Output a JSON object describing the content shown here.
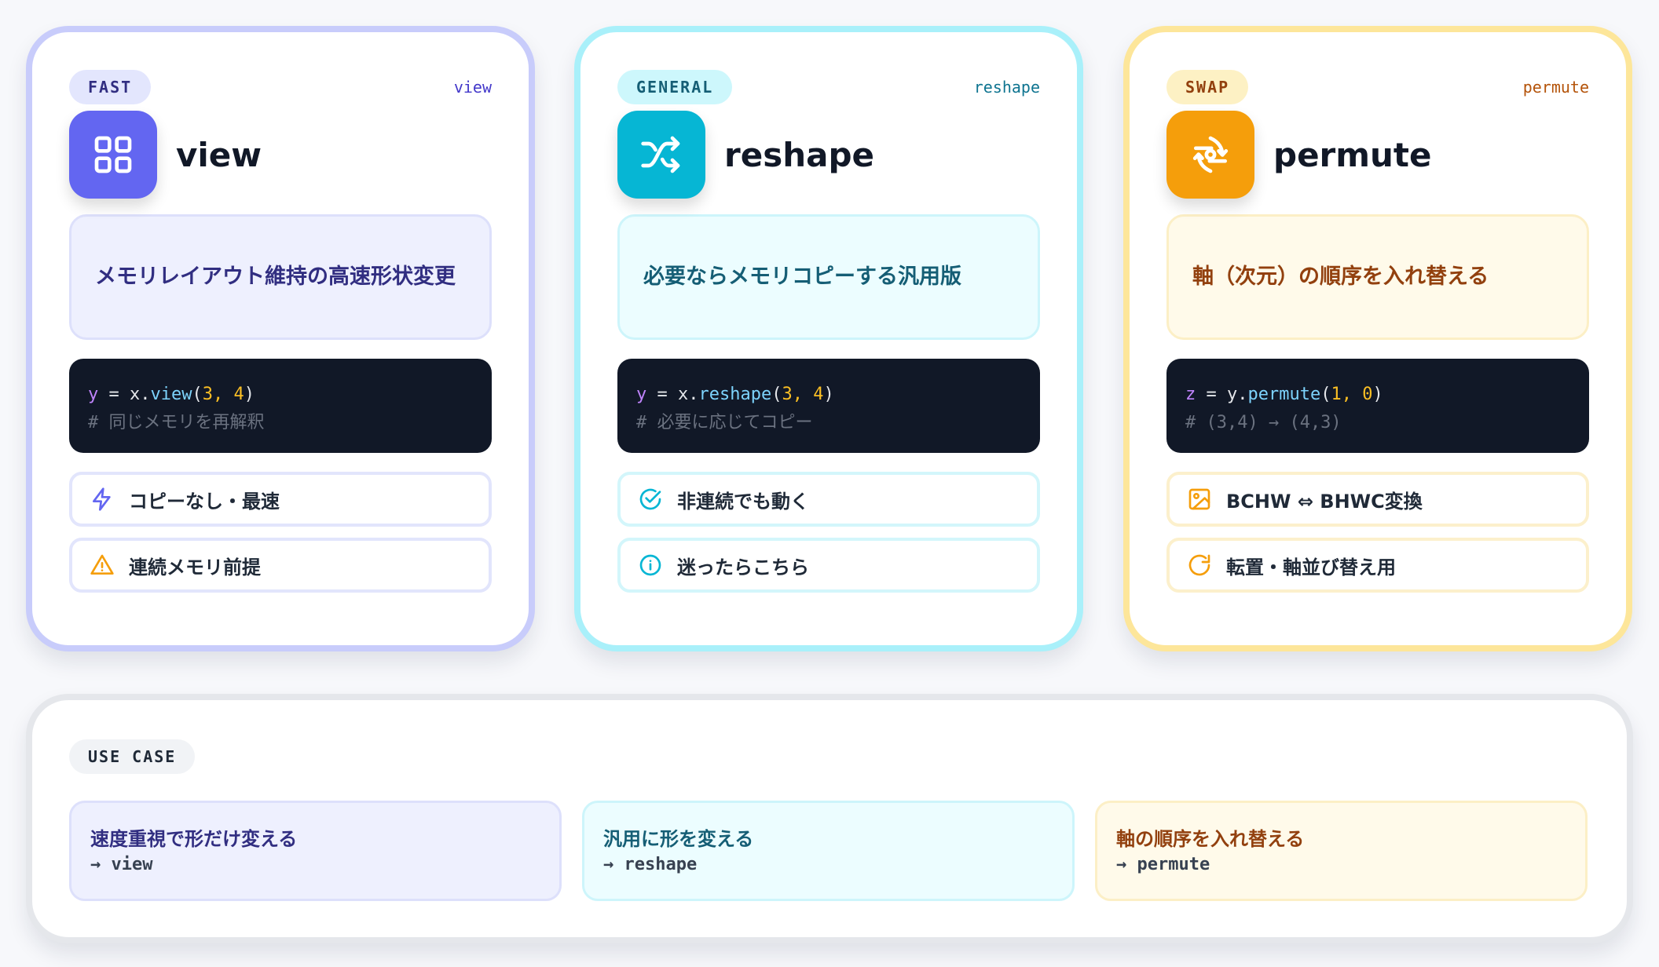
{
  "cards": [
    {
      "badge": "FAST",
      "api_tag": "view",
      "title": "view",
      "description": "メモリレイアウト維持の高速形状変更",
      "code": {
        "var": "y",
        "eq": " = ",
        "obj": "x.",
        "fn": "view",
        "open": "(",
        "arg1": "3",
        "sep": ", ",
        "arg2": "4",
        "close": ")",
        "comment": "# 同じメモリを再解釈"
      },
      "features": [
        "コピーなし・最速",
        "連続メモリ前提"
      ],
      "icon": "grid-icon",
      "feature_icons": [
        "lightning-icon",
        "warning-icon"
      ],
      "accent": "#6366f1"
    },
    {
      "badge": "GENERAL",
      "api_tag": "reshape",
      "title": "reshape",
      "description": "必要ならメモリコピーする汎用版",
      "code": {
        "var": "y",
        "eq": " = ",
        "obj": "x.",
        "fn": "reshape",
        "open": "(",
        "arg1": "3",
        "sep": ", ",
        "arg2": "4",
        "close": ")",
        "comment": "# 必要に応じてコピー"
      },
      "features": [
        "非連続でも動く",
        "迷ったらこちら"
      ],
      "icon": "shuffle-icon",
      "feature_icons": [
        "check-circle-icon",
        "info-icon"
      ],
      "accent": "#06b6d4"
    },
    {
      "badge": "SWAP",
      "api_tag": "permute",
      "title": "permute",
      "description": "軸（次元）の順序を入れ替える",
      "code": {
        "var": "z",
        "eq": " = ",
        "obj": "y.",
        "fn": "permute",
        "open": "(",
        "arg1": "1",
        "sep": ", ",
        "arg2": "0",
        "close": ")",
        "comment": "# (3,4) → (4,3)"
      },
      "features": [
        "BCHW ⇔ BHWC変換",
        "転置・軸並び替え用"
      ],
      "icon": "rotate-axes-icon",
      "feature_icons": [
        "image-icon",
        "refresh-icon"
      ],
      "accent": "#f59e0b"
    }
  ],
  "use_case": {
    "badge": "USE CASE",
    "items": [
      {
        "title": "速度重視で形だけ変える",
        "api": "→ view"
      },
      {
        "title": "汎用に形を変える",
        "api": "→ reshape"
      },
      {
        "title": "軸の順序を入れ替える",
        "api": "→ permute"
      }
    ]
  }
}
